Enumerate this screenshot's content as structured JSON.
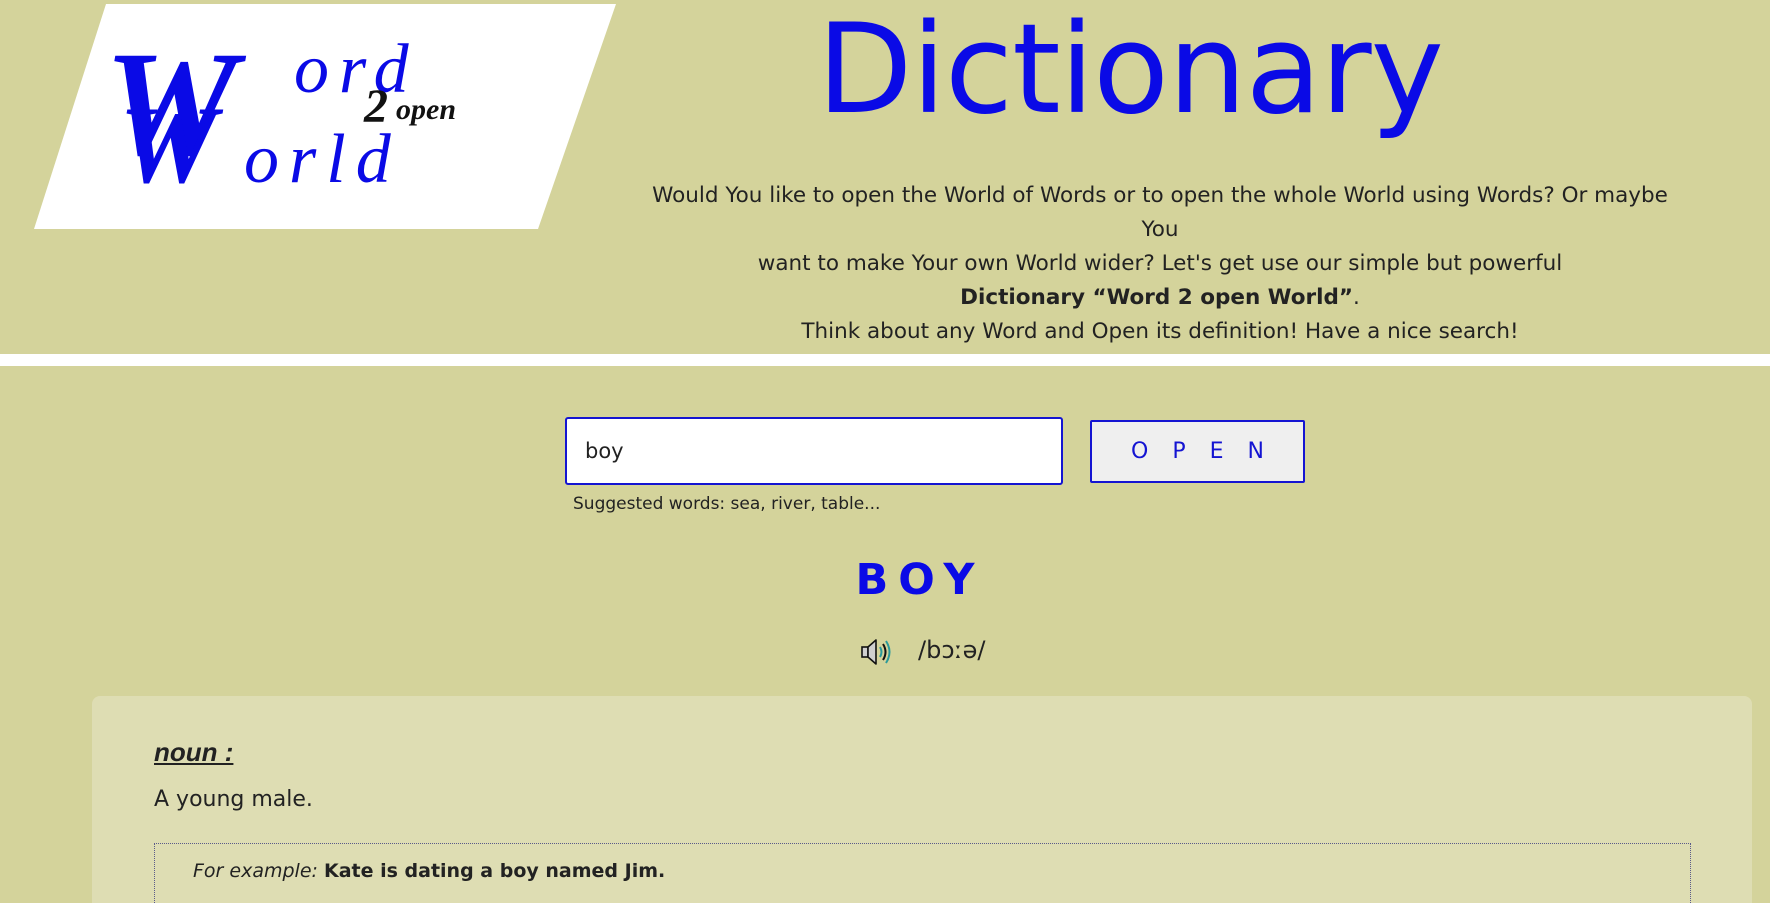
{
  "header": {
    "logo": {
      "big_w_top": "W",
      "big_w_bottom": "W",
      "ord": "ord",
      "orld": "orld",
      "two": "2",
      "open": "open",
      "logo_colors": {
        "primary": "#0a0ae6",
        "secondary": "#111111",
        "panel": "#ffffff"
      }
    },
    "title": "Dictionary",
    "intro_line1": "Would You like to open the World of Words or to open the whole World using Words? Or maybe You",
    "intro_line2": "want to make Your own World wider? Let's get use our simple but powerful",
    "intro_line3_bold": "Dictionary “Word 2 open World”",
    "intro_line3_tail": ".",
    "intro_line4": "Think about any Word and Open its definition! Have a nice search!"
  },
  "search": {
    "value": "boy",
    "placeholder": "",
    "button_label": "OPEN",
    "suggested": "Suggested words: sea, river, table..."
  },
  "result": {
    "word": "BOY",
    "speaker_icon": "speaker-icon",
    "phonetic": "/bɔːə/",
    "part_of_speech": "noun :",
    "definition": "A young male.",
    "example_label": "For example:",
    "example_text": "Kate is dating a boy named Jim."
  },
  "colors": {
    "background": "#d4d39b",
    "card": "#deddb3",
    "accent": "#0a0ae6",
    "divider": "#ffffff"
  }
}
